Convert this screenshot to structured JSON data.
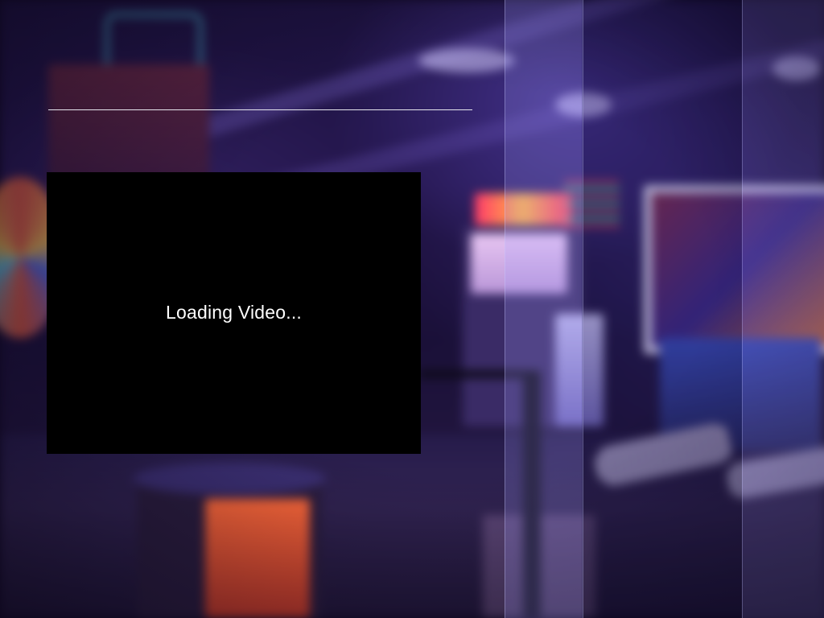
{
  "video_player": {
    "status_text": "Loading Video..."
  },
  "background": {
    "scene": "arcade",
    "tint_color": "#1d1240"
  },
  "colors": {
    "panel_background": "#000000",
    "text": "#ffffff",
    "rule": "#e6e6ee"
  }
}
